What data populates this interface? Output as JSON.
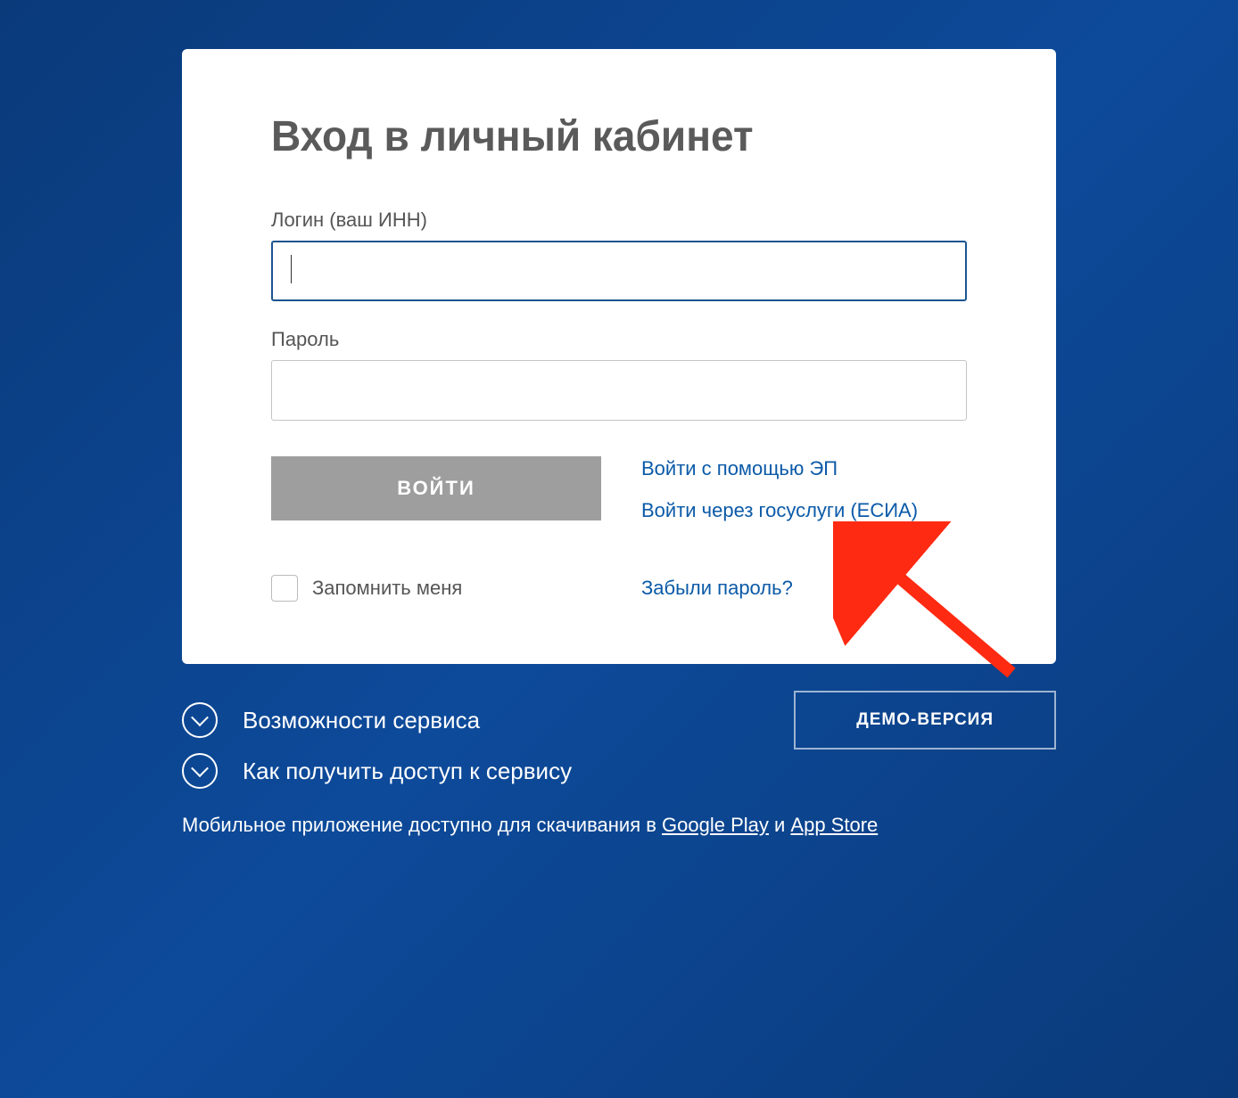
{
  "card": {
    "title": "Вход в личный кабинет",
    "login_label": "Логин (ваш ИНН)",
    "password_label": "Пароль",
    "login_button": "ВОЙТИ",
    "alt_ep": "Войти с помощью ЭП",
    "alt_esia": "Войти через госуслуги (ЕСИА)",
    "remember": "Запомнить меня",
    "forgot": "Забыли пароль?"
  },
  "below": {
    "capabilities": "Возможности сервиса",
    "howto": "Как получить доступ к сервису",
    "demo": "ДЕМО-ВЕРСИЯ",
    "app_prefix": "Мобильное приложение доступно для скачивания в ",
    "google_play": "Google Play",
    "app_and": " и ",
    "app_store": "App Store"
  }
}
